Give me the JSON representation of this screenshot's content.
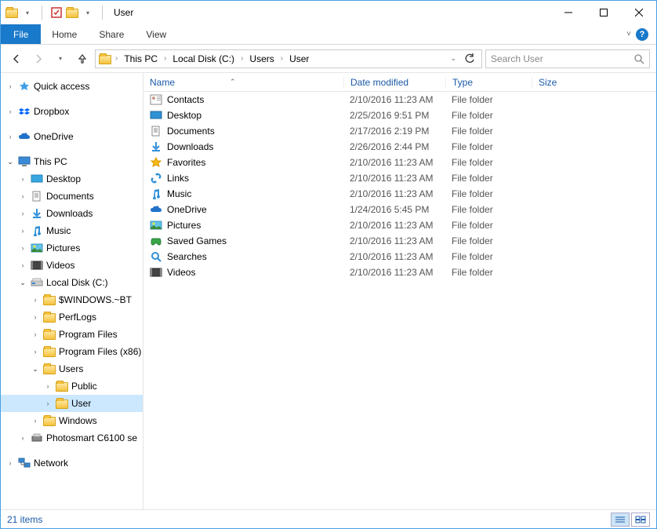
{
  "title": "User",
  "ribbon": {
    "file": "File",
    "home": "Home",
    "share": "Share",
    "view": "View"
  },
  "breadcrumbs": [
    "This PC",
    "Local Disk (C:)",
    "Users",
    "User"
  ],
  "search_placeholder": "Search User",
  "columns": {
    "name": "Name",
    "date": "Date modified",
    "type": "Type",
    "size": "Size"
  },
  "status": "21 items",
  "nav": {
    "quick": "Quick access",
    "dropbox": "Dropbox",
    "onedrive": "OneDrive",
    "thispc": "This PC",
    "desktop": "Desktop",
    "documents": "Documents",
    "downloads": "Downloads",
    "music": "Music",
    "pictures": "Pictures",
    "videos": "Videos",
    "localdisk": "Local Disk (C:)",
    "winbt": "$WINDOWS.~BT",
    "perflogs": "PerfLogs",
    "progfiles": "Program Files",
    "progfiles86": "Program Files (x86)",
    "users": "Users",
    "public": "Public",
    "user": "User",
    "windows": "Windows",
    "photosmart": "Photosmart C6100 se",
    "network": "Network"
  },
  "files": [
    {
      "name": "Contacts",
      "date": "2/10/2016 11:23 AM",
      "type": "File folder",
      "icon": "contacts"
    },
    {
      "name": "Desktop",
      "date": "2/25/2016 9:51 PM",
      "type": "File folder",
      "icon": "desktop"
    },
    {
      "name": "Documents",
      "date": "2/17/2016 2:19 PM",
      "type": "File folder",
      "icon": "documents"
    },
    {
      "name": "Downloads",
      "date": "2/26/2016 2:44 PM",
      "type": "File folder",
      "icon": "downloads"
    },
    {
      "name": "Favorites",
      "date": "2/10/2016 11:23 AM",
      "type": "File folder",
      "icon": "favorites"
    },
    {
      "name": "Links",
      "date": "2/10/2016 11:23 AM",
      "type": "File folder",
      "icon": "links"
    },
    {
      "name": "Music",
      "date": "2/10/2016 11:23 AM",
      "type": "File folder",
      "icon": "music"
    },
    {
      "name": "OneDrive",
      "date": "1/24/2016 5:45 PM",
      "type": "File folder",
      "icon": "onedrive"
    },
    {
      "name": "Pictures",
      "date": "2/10/2016 11:23 AM",
      "type": "File folder",
      "icon": "pictures"
    },
    {
      "name": "Saved Games",
      "date": "2/10/2016 11:23 AM",
      "type": "File folder",
      "icon": "savedgames"
    },
    {
      "name": "Searches",
      "date": "2/10/2016 11:23 AM",
      "type": "File folder",
      "icon": "searches"
    },
    {
      "name": "Videos",
      "date": "2/10/2016 11:23 AM",
      "type": "File folder",
      "icon": "videos"
    }
  ]
}
